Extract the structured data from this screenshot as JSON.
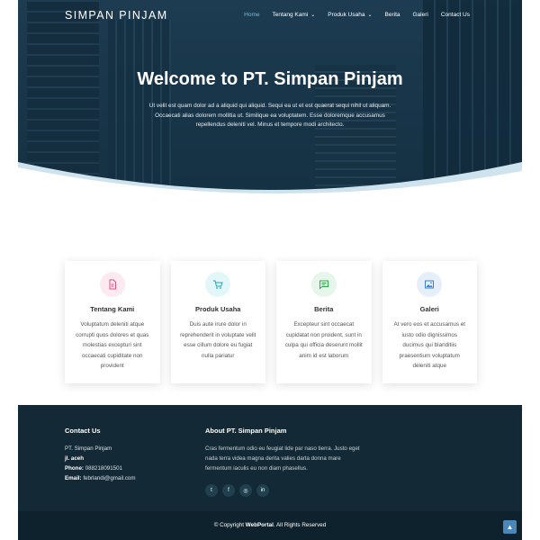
{
  "brand": "SIMPAN PINJAM",
  "nav": [
    {
      "label": "Home",
      "active": true,
      "dropdown": false
    },
    {
      "label": "Tentang Kami",
      "active": false,
      "dropdown": true
    },
    {
      "label": "Produk Usaha",
      "active": false,
      "dropdown": true
    },
    {
      "label": "Berita",
      "active": false,
      "dropdown": false
    },
    {
      "label": "Galeri",
      "active": false,
      "dropdown": false
    },
    {
      "label": "Contact Us",
      "active": false,
      "dropdown": false
    }
  ],
  "hero": {
    "title": "Welcome to PT. Simpan Pinjam",
    "text": "Ut velit est quam dolor ad a aliquid qui aliquid. Sequi ea ut et est quaerat sequi nihil ut aliquam. Occaecati alias dolorem mollitia ut. Similique ea voluptatem. Esse doloremque accusamus repellendus deleniti vel. Minus et tempore modi architecto."
  },
  "cards": [
    {
      "title": "Tentang Kami",
      "icon": "document-icon",
      "color": "#e0507e",
      "bg": "#fdeaf1",
      "text": "Voluptatum deleniti atque corrupti quos dolores et quas molestias excepturi sint occaecati cupiditate non provident"
    },
    {
      "title": "Produk Usaha",
      "icon": "cart-icon",
      "color": "#1aa5b8",
      "bg": "#e3f7f9",
      "text": "Duis aute irure dolor in reprehenderit in voluptate velit esse cillum dolore eu fugiat nulla pariatur"
    },
    {
      "title": "Berita",
      "icon": "message-icon",
      "color": "#2ea84a",
      "bg": "#e6f6ea",
      "text": "Excepteur sint occaecat cupidatat non proident, sunt in culpa qui officia deserunt mollit anim id est laborum"
    },
    {
      "title": "Galeri",
      "icon": "image-icon",
      "color": "#3b7ec9",
      "bg": "#e6eff9",
      "text": "At vero eos et accusamus et iusto odio dignissimos ducimus qui blanditiis praesentium voluptatum deleniti atque"
    }
  ],
  "footer": {
    "contact_heading": "Contact Us",
    "company": "PT. Simpan Pinjam",
    "address": "jl. aceh",
    "phone_label": "Phone:",
    "phone": "088218091501",
    "email_label": "Email:",
    "email": "febrlandi@gmail.com",
    "about_heading": "About PT. Simpan Pinjam",
    "about_text": "Cras fermentum odio eu feugiat lide par naso tierra. Justo eget nada terra videa magna derita valies darta donna mare fermentum iaculis eu non diam phasellus.",
    "socials": [
      {
        "name": "twitter",
        "glyph": "t"
      },
      {
        "name": "facebook",
        "glyph": "f"
      },
      {
        "name": "instagram",
        "glyph": "◎"
      },
      {
        "name": "linkedin",
        "glyph": "in"
      }
    ],
    "copyright_prefix": "© Copyright ",
    "copyright_brand": "WebPortal",
    "copyright_suffix": ". All Rights Reserved"
  }
}
